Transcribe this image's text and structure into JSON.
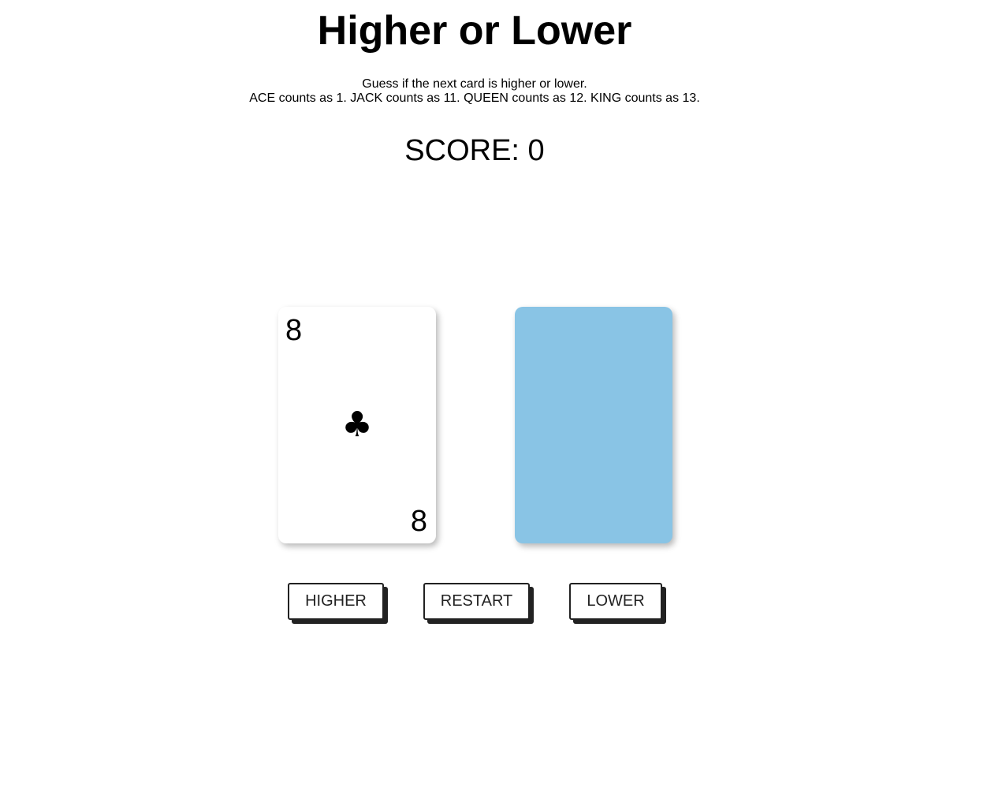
{
  "game": {
    "title": "Higher or Lower",
    "instructions": {
      "line1": "Guess if the next card is higher or lower.",
      "line2": "ACE counts as 1. JACK counts as 11. QUEEN counts as 12. KING counts as 13."
    },
    "score_text": "SCORE: 0",
    "current_card": {
      "rank": "8",
      "suit": "clubs",
      "suit_symbol": "♣",
      "face_color": "#ffffff"
    },
    "next_card": {
      "face_down": true,
      "back_color": "#89c4e5"
    },
    "buttons": {
      "higher_label": "HIGHER",
      "restart_label": "RESTART",
      "lower_label": "LOWER"
    }
  }
}
